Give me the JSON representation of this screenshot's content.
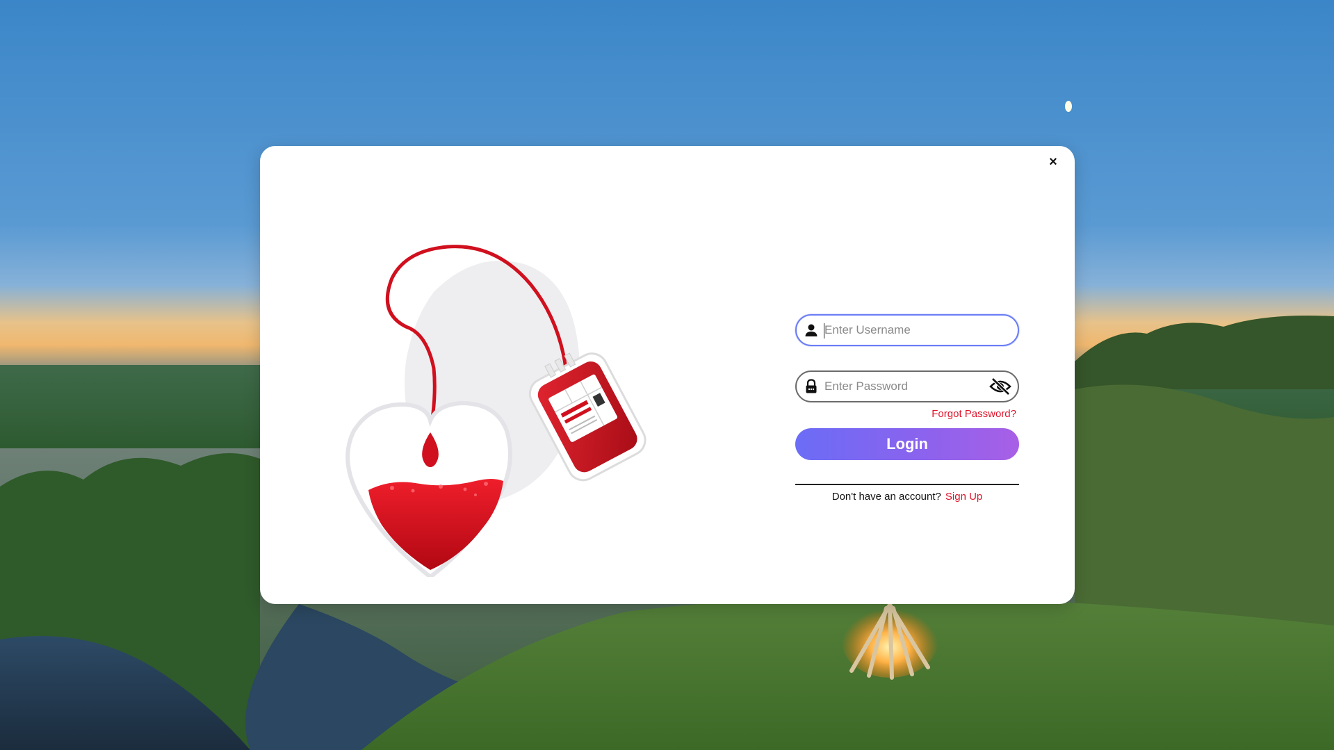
{
  "dialog": {
    "close_label": "×"
  },
  "login_form": {
    "username": {
      "placeholder": "Enter Username",
      "value": ""
    },
    "password": {
      "placeholder": "Enter Password",
      "value": ""
    },
    "forgot_password_label": "Forgot Password?",
    "login_label": "Login",
    "no_account_text": "Don't have an account?",
    "signup_label": "Sign Up"
  },
  "icons": {
    "username": "user-icon",
    "password": "lock-icon",
    "visibility": "eye-slash-icon",
    "close": "close-icon"
  },
  "colors": {
    "accent_start": "#6b6cf6",
    "accent_end": "#a85fe6",
    "link_red": "#e0142a",
    "focus_border": "#6a7df5",
    "blood_red": "#d0101e"
  }
}
